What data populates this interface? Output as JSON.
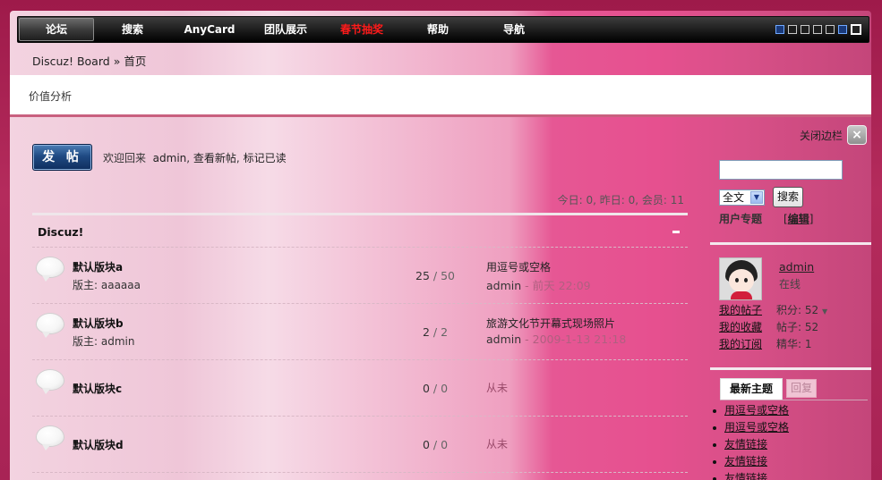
{
  "nav": {
    "items": [
      {
        "label": "论坛",
        "active": true
      },
      {
        "label": "搜索"
      },
      {
        "label": "AnyCard"
      },
      {
        "label": "团队展示"
      },
      {
        "label": "春节抽奖",
        "highlight": true
      },
      {
        "label": "帮助"
      },
      {
        "label": "导航"
      }
    ]
  },
  "breadcrumb": {
    "home": "Discuz! Board",
    "sep": "»",
    "current": "首页"
  },
  "panel": {
    "tab": "价值分析"
  },
  "post_button": "发 帖",
  "welcome": {
    "prefix": "欢迎回来",
    "user": "admin",
    "new_posts": "查看新帖",
    "mark_read": "标记已读"
  },
  "stats": "今日: 0, 昨日: 0, 会员: 11",
  "category": {
    "title": "Discuz!",
    "toggle": "-"
  },
  "forums": [
    {
      "name": "默认版块a",
      "moderator": "版主: aaaaaa",
      "threads": "25",
      "posts": "50",
      "last_title": "用逗号或空格",
      "last_by": "admin",
      "last_time": "- 前天 22:09"
    },
    {
      "name": "默认版块b",
      "moderator": "版主: admin",
      "threads": "2",
      "posts": "2",
      "last_title": "旅游文化节开幕式现场照片",
      "last_by": "admin",
      "last_time": "- 2009-1-13 21:18"
    },
    {
      "name": "默认版块c",
      "threads": "0",
      "posts": "0",
      "last_never": "从未"
    },
    {
      "name": "默认版块d",
      "threads": "0",
      "posts": "0",
      "last_never": "从未"
    }
  ],
  "sidebar": {
    "close_label": "关闭边栏",
    "close_icon": "×",
    "search_select": "全文",
    "search_button": "搜索",
    "user_topic": "用户专题",
    "edit": "编辑",
    "user": {
      "name": "admin",
      "status": "在线"
    },
    "links": [
      "我的帖子",
      "我的收藏",
      "我的订阅"
    ],
    "user_stats": [
      "积分: 52",
      "帖子: 52",
      "精华: 1"
    ],
    "tabs": {
      "new": "最新主题",
      "reply": "回复"
    },
    "topics": [
      "用逗号或空格",
      "用逗号或空格",
      "友情链接",
      "友情链接",
      "友情链接"
    ]
  }
}
